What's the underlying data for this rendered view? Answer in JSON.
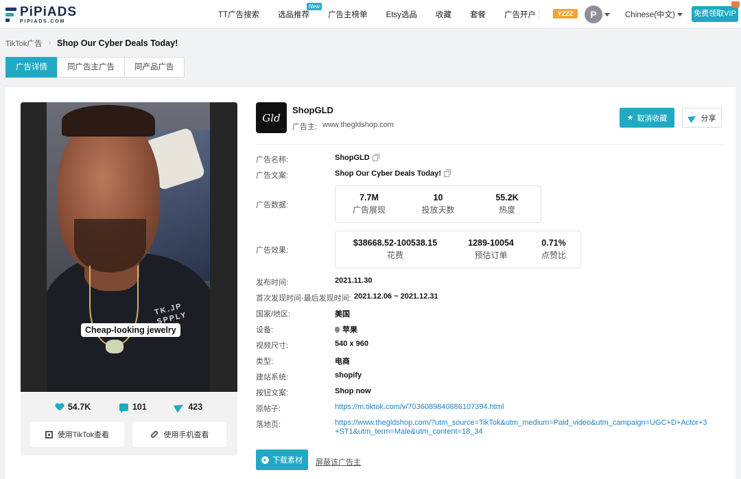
{
  "header": {
    "logo_title": "PiPiADS",
    "logo_sub": "PIPIADS.COM",
    "nav": [
      {
        "label": "TT广告搜索"
      },
      {
        "label": "选品推荐",
        "badge": "New"
      },
      {
        "label": "广告主榜单"
      },
      {
        "label": "Etsy选品"
      },
      {
        "label": "收藏"
      },
      {
        "label": "套餐"
      },
      {
        "label": "广告开户"
      }
    ],
    "yz_badge": "YZZZ",
    "avatar_letter": "P",
    "language": "Chinese(中文)",
    "vip_button": "免费领取VIP"
  },
  "breadcrumb": {
    "root": "TikTok广告",
    "current": "Shop Our Cyber Deals Today!"
  },
  "tabs": [
    {
      "label": "广告详情",
      "active": true
    },
    {
      "label": "同广告主广告",
      "active": false
    },
    {
      "label": "同产品广告",
      "active": false
    }
  ],
  "video": {
    "caption": "Cheap-looking jewelry",
    "shirt_text": "TK.JP SPPLY",
    "stats": {
      "likes": "54.7K",
      "comments": "101",
      "shares": "423"
    },
    "buttons": {
      "tiktok": "使用TikTok查看",
      "phone": "使用手机查看"
    }
  },
  "advertiser": {
    "logo_text": "Gld",
    "name": "ShopGLD",
    "label": "广告主:",
    "website": "www.thegldshop.com",
    "fav_button": "取消收藏",
    "share_button": "分享"
  },
  "details": {
    "ad_name_label": "广告名称:",
    "ad_name": "ShopGLD",
    "ad_copy_label": "广告文案:",
    "ad_copy": "Shop Our Cyber Deals Today!",
    "data_label": "广告数据:",
    "data_metrics": [
      {
        "value": "7.7M",
        "label": "广告展现"
      },
      {
        "value": "10",
        "label": "投放天数"
      },
      {
        "value": "55.2K",
        "label": "热度"
      }
    ],
    "effect_label": "广告效果:",
    "effect_metrics": [
      {
        "value": "$38668.52-100538.15",
        "label": "花费"
      },
      {
        "value": "1289-10054",
        "label": "预估订单"
      },
      {
        "value": "0.71%",
        "label": "点赞比"
      }
    ],
    "publish_label": "发布时间:",
    "publish_time": "2021.11.30",
    "seen_label": "首次发现时间-最后发现时间:",
    "seen_range": "2021.12.06 ~ 2021.12.31",
    "country_label": "国家/地区:",
    "country": "美国",
    "device_label": "设备:",
    "device": "苹果",
    "size_label": "视频尺寸:",
    "size": "540 x 960",
    "type_label": "类型:",
    "type": "电商",
    "site_label": "建站系统:",
    "site_system": "shopify",
    "cta_label": "按钮文案:",
    "cta": "Shop now",
    "post_label": "原帖子:",
    "post_url": "https://m.tiktok.com/v/7036089840886107394.html",
    "landing_label": "落地页:",
    "landing_url_line1": "https://www.thegldshop.com/?utm_source=TikTok&utm_medium=Paid_video&utm_campaign=UGC+D+Actor+3",
    "landing_url_line2": "+ST1&utm_term=Male&utm_content=18_34",
    "download_button": "下载素材",
    "block_link": "屏蔽该广告主"
  }
}
